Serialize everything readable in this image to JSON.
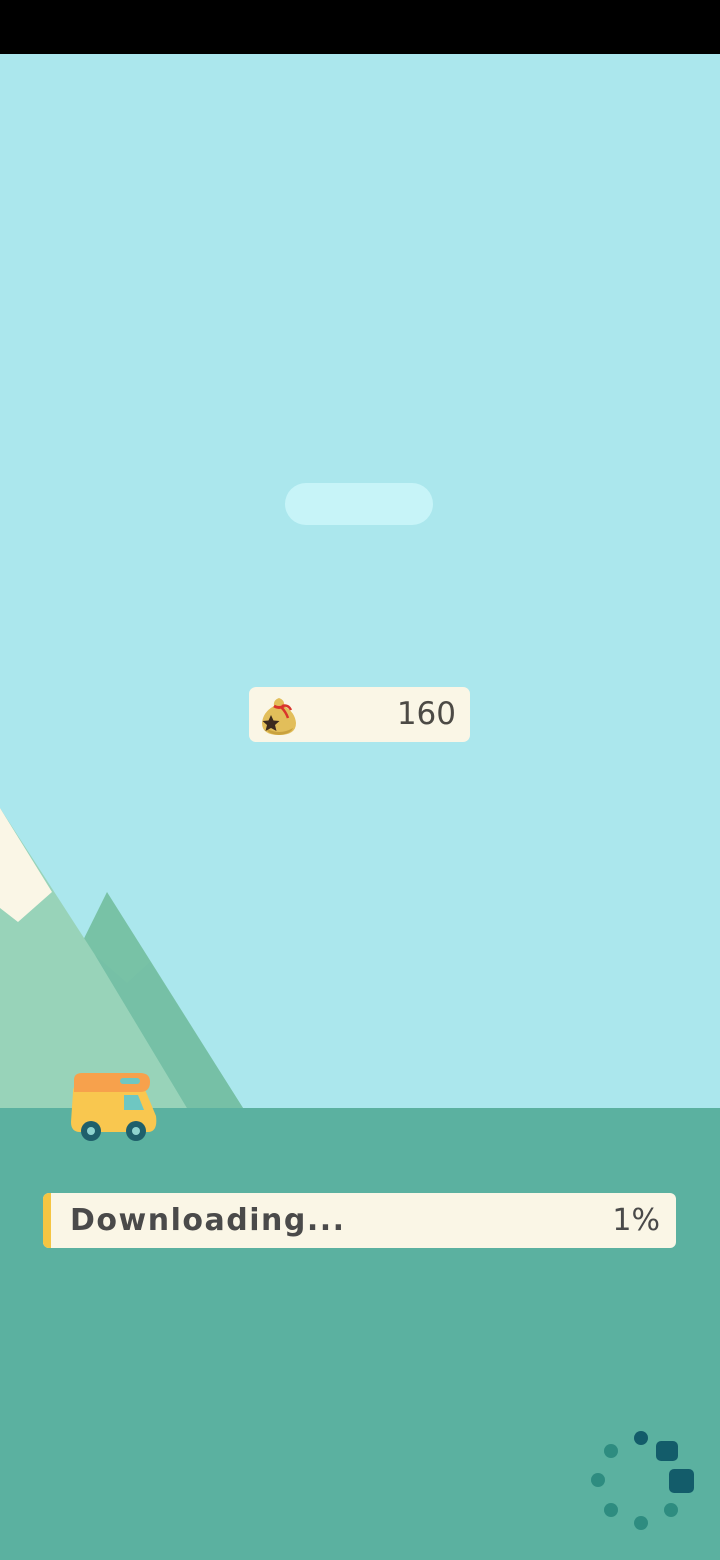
{
  "currency": {
    "icon": "bells-bag-icon",
    "value": "160"
  },
  "progress": {
    "label": "Downloading...",
    "percent_text": "1%",
    "fraction": 0.01
  },
  "loading_indicator": {
    "icon": "loading-spinner-icon"
  },
  "colors": {
    "sky": "#ABE7ED",
    "ground": "#5BB1A0",
    "progress_fill": "#F5C542",
    "panel": "#FAF6E6",
    "text": "#4A4A4A"
  }
}
